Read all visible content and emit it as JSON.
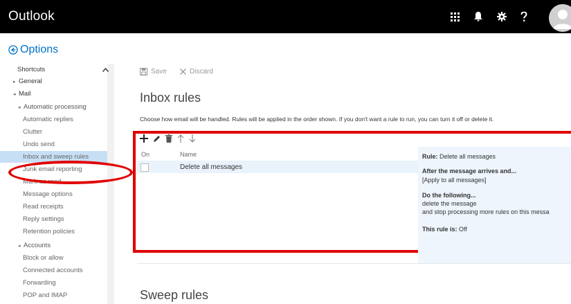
{
  "header": {
    "app_title": "Outlook"
  },
  "options": {
    "title": "Options"
  },
  "nav": {
    "items": [
      {
        "label": "Shortcuts",
        "level": 0
      },
      {
        "label": "General",
        "level": 1,
        "caret": "▸"
      },
      {
        "label": "Mail",
        "level": 1,
        "caret": "◂"
      },
      {
        "label": "Automatic processing",
        "level": 2,
        "caret": "◂"
      },
      {
        "label": "Automatic replies",
        "level": 3
      },
      {
        "label": "Clutter",
        "level": 3
      },
      {
        "label": "Undo send",
        "level": 3
      },
      {
        "label": "Inbox and sweep rules",
        "level": 3,
        "selected": true
      },
      {
        "label": "Junk email reporting",
        "level": 3
      },
      {
        "label": "Mark as read",
        "level": 3
      },
      {
        "label": "Message options",
        "level": 3
      },
      {
        "label": "Read receipts",
        "level": 3
      },
      {
        "label": "Reply settings",
        "level": 3
      },
      {
        "label": "Retention policies",
        "level": 3
      },
      {
        "label": "Accounts",
        "level": 2,
        "caret": "◂"
      },
      {
        "label": "Block or allow",
        "level": 3
      },
      {
        "label": "Connected accounts",
        "level": 3
      },
      {
        "label": "Forwarding",
        "level": 3
      },
      {
        "label": "POP and IMAP",
        "level": 3
      }
    ]
  },
  "toolbar": {
    "save_label": "Save",
    "discard_label": "Discard"
  },
  "inbox_rules": {
    "title": "Inbox rules",
    "description": "Choose how email will be handled. Rules will be applied in the order shown. If you don't want a rule to run, you can turn it off or delete it.",
    "columns": {
      "on": "On",
      "name": "Name"
    },
    "rows": [
      {
        "name": "Delete all messages",
        "on": false
      }
    ],
    "details": {
      "rule_label": "Rule:",
      "rule_value": "Delete all messages",
      "condition_heading": "After the message arrives and...",
      "condition_value": "[Apply to all messages]",
      "action_heading": "Do the following...",
      "action_line1": "delete the message",
      "action_line2": "and stop processing more rules on this messa",
      "status_label": "This rule is:",
      "status_value": "Off"
    }
  },
  "sweep_rules": {
    "title": "Sweep rules"
  },
  "colors": {
    "accent": "#0072c6",
    "annotation": "#e00000",
    "selected_nav": "#c7dff5"
  }
}
